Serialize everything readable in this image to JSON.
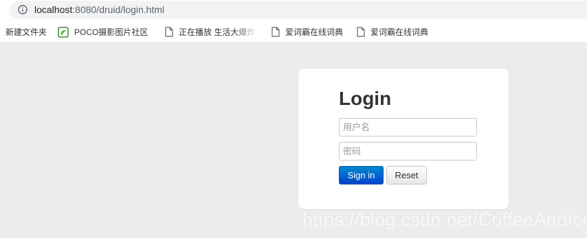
{
  "address_bar": {
    "host": "localhost",
    "rest": ":8080/druid/login.html"
  },
  "bookmarks": [
    {
      "label": "新建文件夹",
      "icon": "none"
    },
    {
      "label": "POCO摄影图片社区",
      "icon": "poco-favicon"
    },
    {
      "label": "正在播放 生活大爆炸",
      "icon": "page-icon"
    },
    {
      "label": "爱词霸在线词典",
      "icon": "page-icon"
    },
    {
      "label": "爱词霸在线词典",
      "icon": "page-icon"
    }
  ],
  "login": {
    "title": "Login",
    "username_placeholder": "用户名",
    "password_placeholder": "密码",
    "signin_label": "Sign in",
    "reset_label": "Reset"
  },
  "watermark": "https://blog.csdn.net/CoffeeAndIce",
  "colors": {
    "page_bg": "#ececec",
    "card_bg": "#ffffff",
    "primary_button": "#0066cc"
  }
}
